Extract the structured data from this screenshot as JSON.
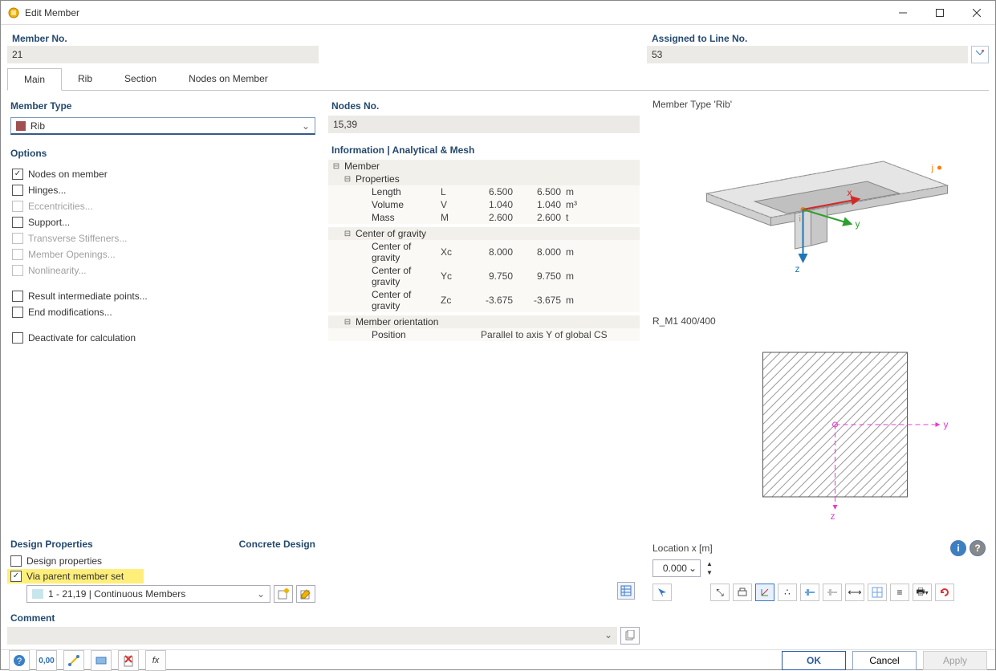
{
  "window": {
    "title": "Edit Member"
  },
  "labels": {
    "member_no": "Member No.",
    "assigned_to": "Assigned to Line No.",
    "member_type": "Member Type",
    "options": "Options",
    "design_properties": "Design Properties",
    "concrete_design": "Concrete Design",
    "nodes_no": "Nodes No.",
    "info_section": "Information | Analytical & Mesh",
    "member_type_preview": "Member Type 'Rib'",
    "section_name": "R_M1 400/400",
    "location_x": "Location x [m]",
    "comment": "Comment"
  },
  "values": {
    "member_no": "21",
    "assigned_to": "53",
    "member_type": "Rib",
    "nodes_no": "15,39",
    "location_x": "0.000",
    "member_set": "1 - 21,19 | Continuous Members"
  },
  "tabs": [
    {
      "label": "Main",
      "active": true
    },
    {
      "label": "Rib",
      "active": false
    },
    {
      "label": "Section",
      "active": false
    },
    {
      "label": "Nodes on Member",
      "active": false
    }
  ],
  "options": [
    {
      "label": "Nodes on member",
      "checked": true,
      "disabled": false
    },
    {
      "label": "Hinges...",
      "checked": false,
      "disabled": false
    },
    {
      "label": "Eccentricities...",
      "checked": false,
      "disabled": true
    },
    {
      "label": "Support...",
      "checked": false,
      "disabled": false
    },
    {
      "label": "Transverse Stiffeners...",
      "checked": false,
      "disabled": true
    },
    {
      "label": "Member Openings...",
      "checked": false,
      "disabled": true
    },
    {
      "label": "Nonlinearity...",
      "checked": false,
      "disabled": true
    },
    {
      "label": "Result intermediate points...",
      "checked": false,
      "disabled": false
    },
    {
      "label": "End modifications...",
      "checked": false,
      "disabled": false
    },
    {
      "label": "Deactivate for calculation",
      "checked": false,
      "disabled": false
    }
  ],
  "design_options": [
    {
      "label": "Design properties",
      "checked": false
    },
    {
      "label": "Via parent member set",
      "checked": true,
      "highlight": true
    }
  ],
  "info_tree": {
    "root": "Member",
    "properties": {
      "title": "Properties",
      "rows": [
        {
          "label": "Length",
          "sym": "L",
          "v1": "6.500",
          "v2": "6.500",
          "unit": "m"
        },
        {
          "label": "Volume",
          "sym": "V",
          "v1": "1.040",
          "v2": "1.040",
          "unit": "m³"
        },
        {
          "label": "Mass",
          "sym": "M",
          "v1": "2.600",
          "v2": "2.600",
          "unit": "t"
        }
      ]
    },
    "cog": {
      "title": "Center of gravity",
      "rows": [
        {
          "label": "Center of gravity",
          "sym": "Xc",
          "v1": "8.000",
          "v2": "8.000",
          "unit": "m"
        },
        {
          "label": "Center of gravity",
          "sym": "Yc",
          "v1": "9.750",
          "v2": "9.750",
          "unit": "m"
        },
        {
          "label": "Center of gravity",
          "sym": "Zc",
          "v1": "-3.675",
          "v2": "-3.675",
          "unit": "m"
        }
      ]
    },
    "orientation": {
      "title": "Member orientation",
      "position_label": "Position",
      "position_value": "Parallel to axis Y of global CS"
    }
  },
  "footer": {
    "ok": "OK",
    "cancel": "Cancel",
    "apply": "Apply"
  }
}
